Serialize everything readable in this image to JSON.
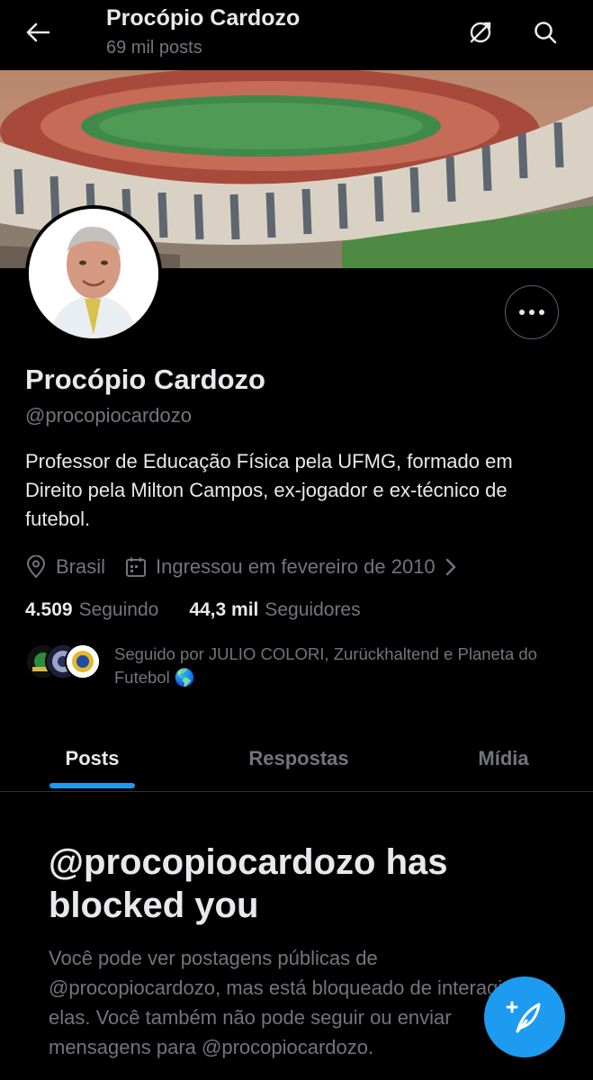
{
  "header": {
    "title": "Procópio Cardozo",
    "post_count": "69 mil posts",
    "icons": [
      "back-arrow-icon",
      "sync-off-icon",
      "search-icon"
    ]
  },
  "profile": {
    "name": "Procópio Cardozo",
    "handle": "@procopiocardozo",
    "bio": "Professor de Educação Física pela UFMG, formado em Direito pela Milton Campos, ex-jogador e ex-técnico de futebol.",
    "location": "Brasil",
    "joined": "Ingressou em fevereiro de 2010",
    "following_count": "4.509",
    "following_label": "Seguindo",
    "followers_count": "44,3 mil",
    "followers_label": "Seguidores",
    "followed_by": "Seguido por JULIO COLORI, Zurückhaltend e Planeta do Futebol 🌎"
  },
  "tabs": [
    {
      "label": "Posts",
      "selected": true
    },
    {
      "label": "Respostas",
      "selected": false
    },
    {
      "label": "Mídia",
      "selected": false
    }
  ],
  "blocked": {
    "title": "@procopiocardozo has blocked you",
    "message": "Você pode ver postagens públicas de @procopiocardozo, mas está bloqueado de interagir com elas. Você também não pode seguir ou enviar mensagens para @procopiocardozo."
  },
  "colors": {
    "background": "#000000",
    "accent": "#1d9bf0",
    "text_primary": "#e7e9ea",
    "text_secondary": "#71767b"
  }
}
